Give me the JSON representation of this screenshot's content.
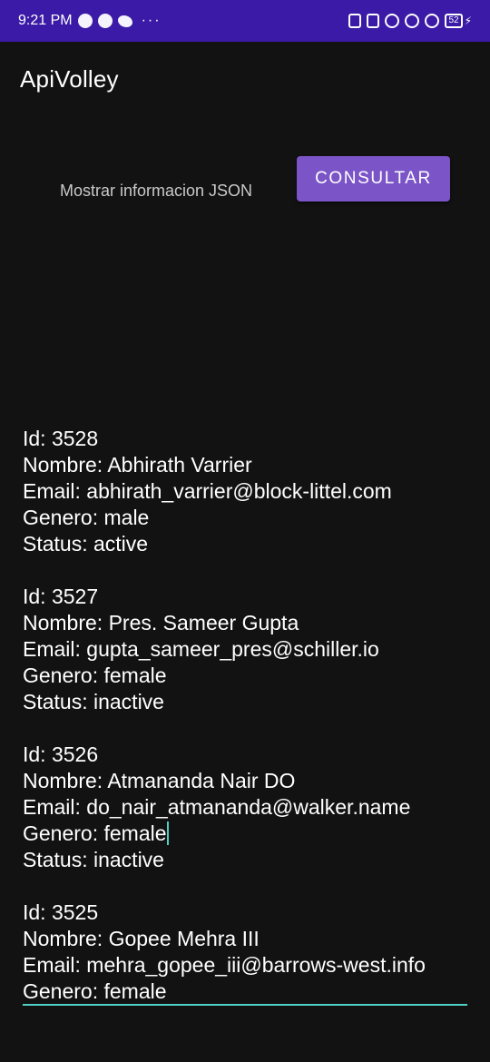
{
  "status_bar": {
    "time": "9:21 PM",
    "dots": "···",
    "battery_level": "52",
    "left_icons": [
      "whatsapp-icon",
      "notification-icon",
      "twitter-icon"
    ],
    "right_icons": [
      "alarm-icon",
      "vibrate-icon",
      "clock-icon",
      "data-saver-icon",
      "sync-icon"
    ]
  },
  "app_bar": {
    "title": "ApiVolley"
  },
  "main": {
    "prompt_label": "Mostrar informacion JSON",
    "consult_button": "CONSULTAR"
  },
  "records": [
    {
      "id": "Id: 3528",
      "nombre": "Nombre: Abhirath Varrier",
      "email": "Email: abhirath_varrier@block-littel.com",
      "genero": "Genero: male",
      "status": "Status: active"
    },
    {
      "id": "Id: 3527",
      "nombre": "Nombre: Pres. Sameer Gupta",
      "email": "Email: gupta_sameer_pres@schiller.io",
      "genero": "Genero: female",
      "status": "Status: inactive"
    },
    {
      "id": "Id: 3526",
      "nombre": "Nombre: Atmananda Nair DO",
      "email": "Email: do_nair_atmananda@walker.name",
      "genero": "Genero: female",
      "status": "Status: inactive"
    },
    {
      "id": "Id: 3525",
      "nombre": "Nombre: Gopee Mehra III",
      "email": "Email: mehra_gopee_iii@barrows-west.info",
      "genero": "Genero: female"
    }
  ],
  "colors": {
    "status_bar": "#3a1aa6",
    "background": "#121212",
    "button": "#7b55c7",
    "accent": "#4fd1c5"
  }
}
